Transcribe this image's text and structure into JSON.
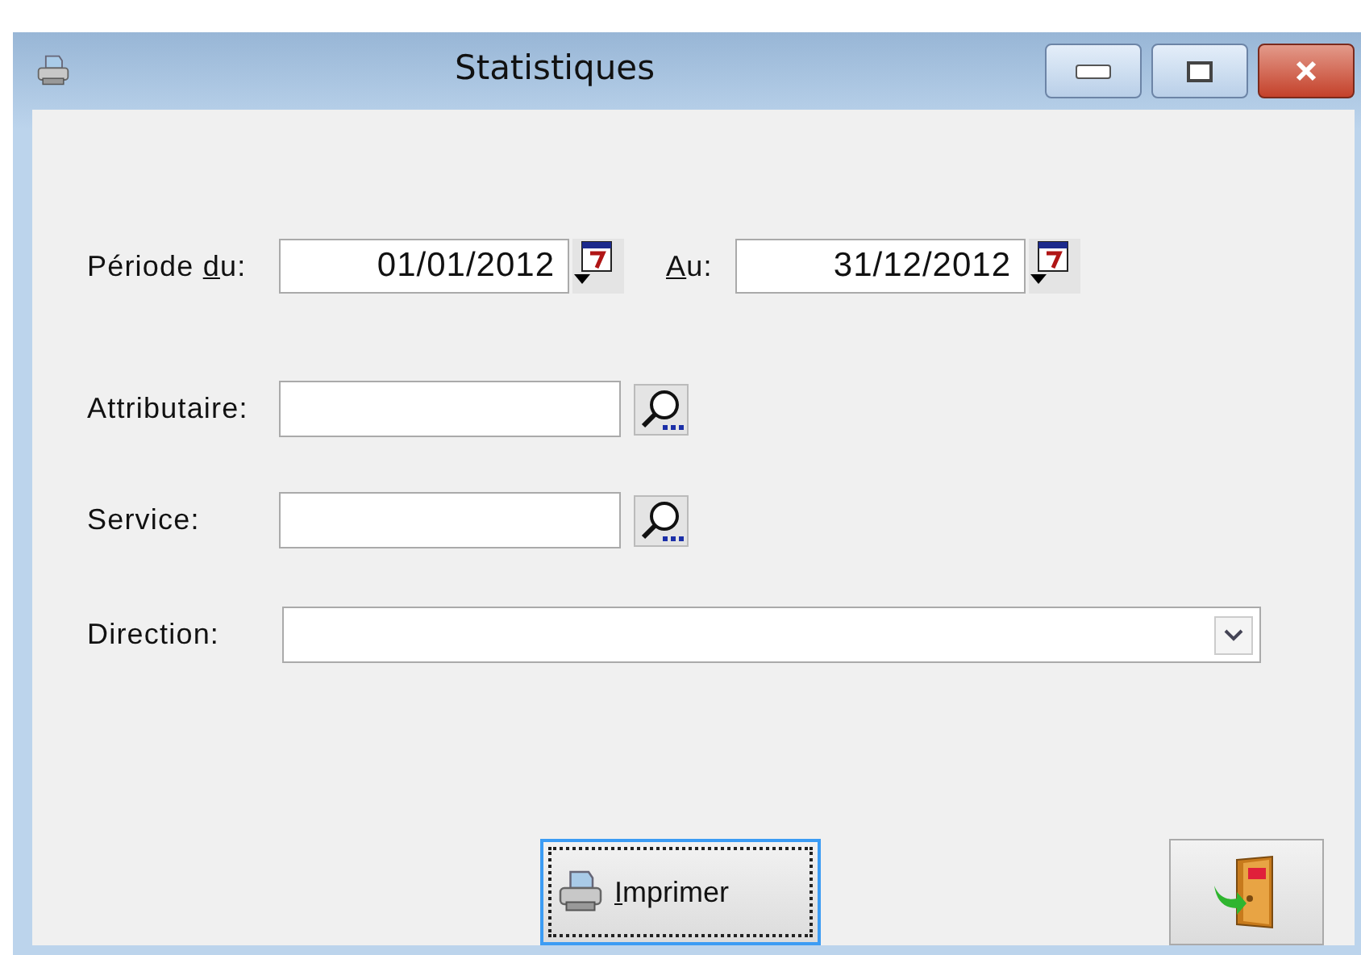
{
  "window": {
    "title": "Statistiques"
  },
  "period": [
    {
      "label": [
        {
          "text": "Période ",
          "underline": false
        },
        {
          "text": "d",
          "underline": true
        },
        {
          "text": "u:",
          "underline": false
        }
      ],
      "value": "01/01/2012"
    },
    {
      "label": [
        {
          "text": "A",
          "underline": true
        },
        {
          "text": "u:",
          "underline": false
        }
      ],
      "value": "31/12/2012"
    }
  ],
  "fields": [
    {
      "label": "Attributaire:",
      "kind": "lookup"
    },
    {
      "label": "Service:",
      "kind": "lookup"
    },
    {
      "label": "Direction:",
      "kind": "combo"
    }
  ],
  "buttons": [
    {
      "kind": "print",
      "focused": true,
      "label": [
        {
          "text": "I",
          "underline": true
        },
        {
          "text": "mprimer",
          "underline": false
        }
      ]
    },
    {
      "kind": "exit",
      "focused": false
    }
  ]
}
